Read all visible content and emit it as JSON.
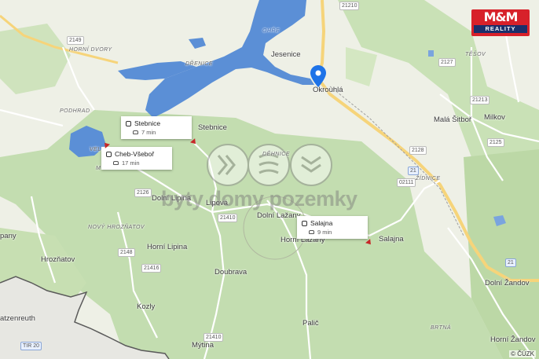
{
  "map": {
    "colors": {
      "water": "#5b8fd6",
      "forest": "#c3ddb0",
      "land": "#eef0e6",
      "road_major": "#f6d47a",
      "road_minor": "#ffffff",
      "border": "#5a5a5a"
    },
    "places": [
      {
        "key": "jesenice",
        "label": "Jesenice"
      },
      {
        "key": "okrouhla",
        "label": "Okrouhlá"
      },
      {
        "key": "stebnice",
        "label": "Stebnice"
      },
      {
        "key": "mala_sitbor",
        "label": "Malá Šitboř"
      },
      {
        "key": "milkov",
        "label": "Milkov"
      },
      {
        "key": "dolni_lipina",
        "label": "Dolní Lipina"
      },
      {
        "key": "lipova",
        "label": "Lipová"
      },
      {
        "key": "dolni_lazany",
        "label": "Dolní Lažany"
      },
      {
        "key": "horni_lazany",
        "label": "Horní Lažany"
      },
      {
        "key": "salajna",
        "label": "Salajna"
      },
      {
        "key": "horni_lipina",
        "label": "Horní Lipina"
      },
      {
        "key": "hrozhatov",
        "label": "Hrozňatov"
      },
      {
        "key": "doubrava",
        "label": "Doubrava"
      },
      {
        "key": "kozly",
        "label": "Kozly"
      },
      {
        "key": "palic",
        "label": "Palič"
      },
      {
        "key": "mytina",
        "label": "Mýtina"
      },
      {
        "key": "dolni_zandov",
        "label": "Dolní Žandov"
      },
      {
        "key": "horni_zandov",
        "label": "Horní Žandov"
      },
      {
        "key": "panny",
        "label": "pany"
      },
      {
        "key": "tzenreuth",
        "label": "atzenreuth"
      }
    ],
    "small_labels": {
      "horni_dvory": "HORNÍ DVORY",
      "drenice": "DŘENICE",
      "podhrad": "PODHRAD",
      "tesov": "TĚŠOV",
      "novy_hroznatov": "NOVÝ HROZŇATOV",
      "zidnice": "ŽÍDNICE",
      "brtna": "BRTNÁ",
      "dehnice": "DĚHNICE",
      "ohre": "OHŘE",
      "velky": "VELKÝ",
      "milhost": "M"
    },
    "roads": {
      "r21210": "21210",
      "r2149": "2149",
      "r2127": "2127",
      "r21213": "21213",
      "r2125": "2125",
      "r2128": "2128",
      "r21": "21",
      "r02111": "02111",
      "r21410": "21410",
      "r2148": "2148",
      "r21416": "21416",
      "r21410b": "21410",
      "r21a": "21",
      "r2126": "2126",
      "tir20": "TIR 20"
    },
    "callouts": [
      {
        "name": "Stebnice",
        "time": "7 min",
        "mode": "car"
      },
      {
        "name": "Cheb-Všeboř",
        "time": "17 min",
        "mode": "car"
      },
      {
        "name": "Salajna",
        "time": "9 min",
        "mode": "car"
      }
    ],
    "logo": {
      "top": "M&M",
      "bottom": "REALITY"
    },
    "watermark": "byty domy pozemky",
    "copyright": "© ČÚZK"
  }
}
